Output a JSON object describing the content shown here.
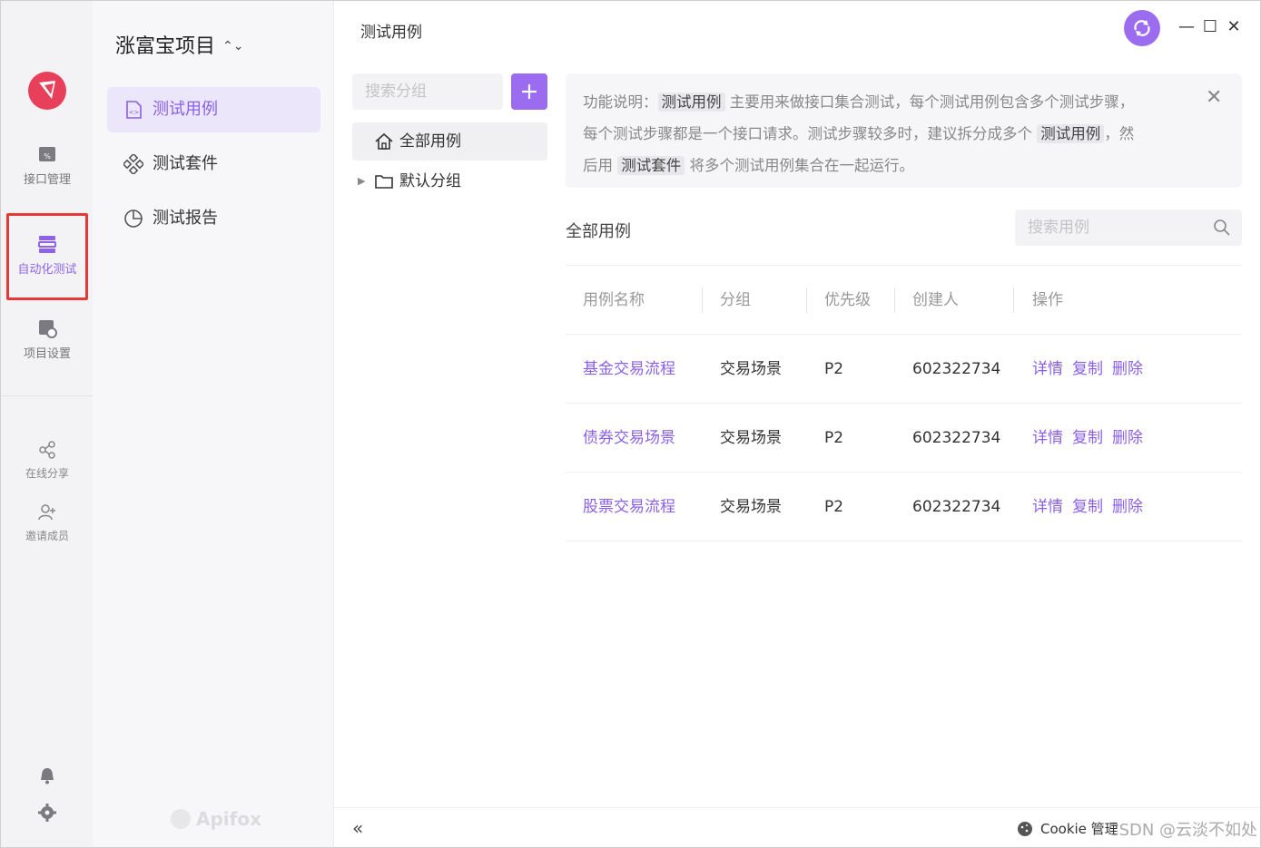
{
  "rail": {
    "items": [
      {
        "label": "接口管理",
        "icon": "api-icon"
      },
      {
        "label": "自动化测试",
        "icon": "automation-icon"
      },
      {
        "label": "项目设置",
        "icon": "project-settings-icon"
      },
      {
        "label": "在线分享",
        "icon": "share-icon"
      },
      {
        "label": "邀请成员",
        "icon": "invite-user-icon"
      }
    ],
    "bottom_icons": [
      "bell-icon",
      "gear-icon"
    ],
    "active_color": "#8f63e8",
    "highlight_color": "#e53935"
  },
  "nav": {
    "project_title": "涨富宝项目",
    "items": [
      {
        "label": "测试用例",
        "icon": "test-case-icon"
      },
      {
        "label": "测试套件",
        "icon": "test-suite-icon"
      },
      {
        "label": "测试报告",
        "icon": "report-icon"
      }
    ],
    "brand": "Apifox"
  },
  "main": {
    "page_title": "测试用例",
    "group_search_placeholder": "搜索分组",
    "tree": [
      {
        "label": "全部用例",
        "icon": "home-icon"
      },
      {
        "label": "默认分组",
        "icon": "folder-icon"
      }
    ],
    "info": {
      "line1_prefix": "功能说明：",
      "tag1": "测试用例",
      "line1_rest": "主要用来做接口集合测试，每个测试用例包含多个测试步骤，",
      "line2_prefix": "每个测试步骤都是一个接口请求。测试步骤较多时，建议拆分成多个",
      "tag2": "测试用例",
      "line2_suffix": "，然",
      "line3_prefix": "后用",
      "tag3": "测试套件",
      "line3_rest": "将多个测试用例集合在一起运行。"
    },
    "section_title": "全部用例",
    "case_search_placeholder": "搜索用例",
    "table": {
      "headers": [
        "用例名称",
        "分组",
        "优先级",
        "创建人",
        "操作"
      ],
      "rows": [
        {
          "name": "基金交易流程",
          "group": "交易场景",
          "priority": "P2",
          "creator": "602322734"
        },
        {
          "name": "债券交易场景",
          "group": "交易场景",
          "priority": "P2",
          "creator": "602322734"
        },
        {
          "name": "股票交易流程",
          "group": "交易场景",
          "priority": "P2",
          "creator": "602322734"
        }
      ],
      "actions": [
        "详情",
        "复制",
        "删除"
      ]
    }
  },
  "footer": {
    "cookie_label": "Cookie 管理",
    "watermark": "CSDN @云淡不如处"
  },
  "accent": "#9b6cf0"
}
